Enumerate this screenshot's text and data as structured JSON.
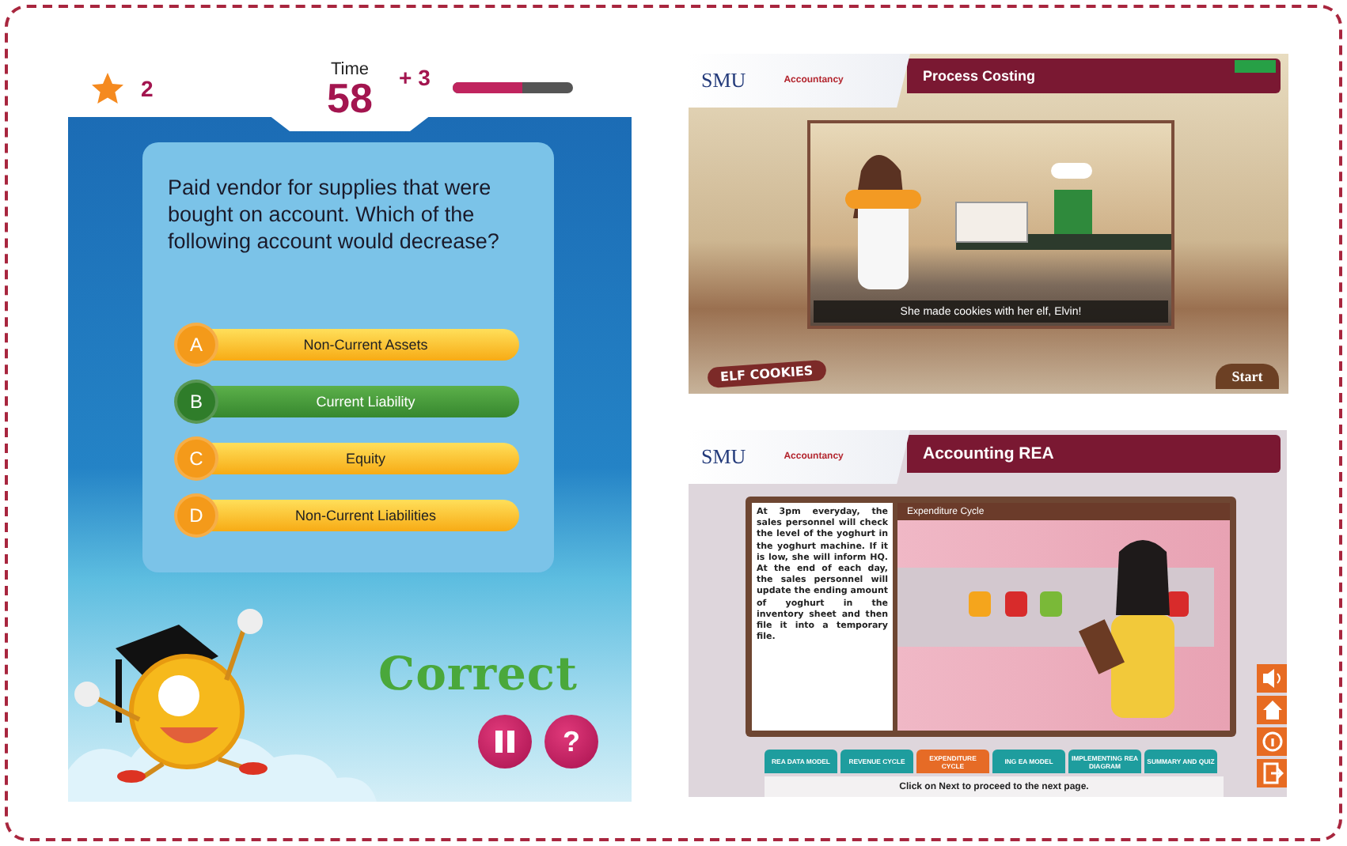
{
  "quiz_game": {
    "score": "2",
    "time_label": "Time",
    "time": "58",
    "bonus": "+ 3",
    "timer": {
      "level": 0.58
    },
    "question": "Paid vendor for supplies that were bought on account. Which of the following account would decrease?",
    "options": [
      {
        "letter": "A",
        "text": "Non-Current Assets",
        "selected": false
      },
      {
        "letter": "B",
        "text": "Current Liability",
        "selected": true
      },
      {
        "letter": "C",
        "text": "Equity",
        "selected": false
      },
      {
        "letter": "D",
        "text": "Non-Current Liabilities",
        "selected": false
      }
    ],
    "feedback": "Correct",
    "buttons": [
      {
        "kind": "pause"
      },
      {
        "kind": "help",
        "label": "?"
      }
    ]
  },
  "process_costing": {
    "logo": "SMU",
    "school": "Accountancy",
    "title": "Process Costing",
    "caption": "She made cookies with her elf, Elvin!",
    "brand": "ELF COOKIES",
    "start_button": "Start"
  },
  "accounting_rea": {
    "logo": "SMU",
    "school": "Accountancy",
    "title": "Accounting REA",
    "narration": "At 3pm everyday, the sales personnel will check the level of the yoghurt in the yoghurt machine. If it is low, she will inform HQ. At the end of each day, the sales personnel will update the ending amount of yoghurt in the inventory sheet and then file it into a temporary file.",
    "scene_title": "Expenditure Cycle",
    "tabs": [
      {
        "label": "REA DATA MODEL",
        "selected": false
      },
      {
        "label": "REVENUE CYCLE",
        "selected": false
      },
      {
        "label": "EXPENDITURE CYCLE",
        "selected": true
      },
      {
        "label": "ING EA MODEL",
        "selected": false
      },
      {
        "label": "IMPLEMENTING REA DIAGRAM",
        "selected": false
      },
      {
        "label": "SUMMARY AND QUIZ",
        "selected": false
      }
    ],
    "instruction": "Click on Next to proceed to the next page.",
    "side_buttons": [
      {
        "kind": "sound"
      },
      {
        "kind": "home"
      },
      {
        "kind": "info"
      },
      {
        "kind": "exit"
      }
    ]
  }
}
